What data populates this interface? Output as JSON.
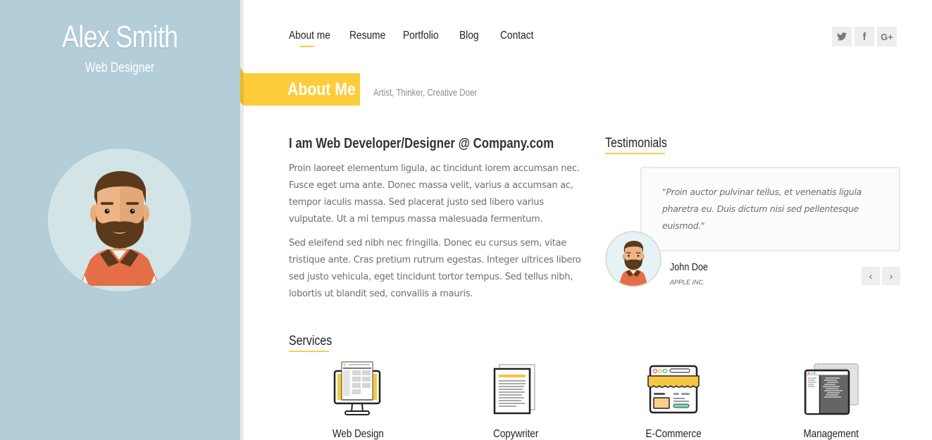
{
  "sidebar": {
    "name": "Alex Smith",
    "role": "Web Designer",
    "avatar_icon": "bearded-man-avatar-icon"
  },
  "nav": {
    "items": [
      {
        "label": "About me",
        "active": true
      },
      {
        "label": "Resume",
        "active": false
      },
      {
        "label": "Portfolio",
        "active": false
      },
      {
        "label": "Blog",
        "active": false
      },
      {
        "label": "Contact",
        "active": false
      }
    ]
  },
  "social": [
    {
      "icon": "twitter-icon",
      "glyph": "🐦"
    },
    {
      "icon": "facebook-icon",
      "glyph": "f"
    },
    {
      "icon": "google-plus-icon",
      "glyph": "G+"
    }
  ],
  "section": {
    "title": "About Me",
    "subtitle": "Artist, Thinker, Creative Doer"
  },
  "about": {
    "heading": "I am Web Developer/Designer @ Company.com",
    "paragraphs": [
      "Proin laoreet elementum ligula, ac tincidunt lorem accumsan nec. Fusce eget urna ante. Donec massa velit, varius a accumsan ac, tempor iaculis massa. Sed placerat justo sed libero varius vulputate. Ut a mi tempus massa malesuada fermentum.",
      "Sed eleifend sed nibh nec fringilla. Donec eu cursus sem, vitae tristique ante. Cras pretium rutrum egestas. Integer ultrices libero sed justo vehicula, eget tincidunt tortor tempus. Sed tellus nibh, lobortis ut blandit sed, convallis a mauris."
    ]
  },
  "testimonials": {
    "title": "Testimonials",
    "quote": "\"Proin auctor pulvinar tellus, et venenatis ligula pharetra eu. Duis dictum nisi sed pellentesque euismod.\"",
    "author": "John Doe",
    "company": "APPLE INC.",
    "prev_glyph": "‹",
    "next_glyph": "›"
  },
  "services": {
    "title": "Services",
    "items": [
      {
        "label": "Web Design",
        "icon": "monitor-webpage-icon"
      },
      {
        "label": "Copywriter",
        "icon": "document-pages-icon"
      },
      {
        "label": "E-Commerce",
        "icon": "storefront-browser-icon"
      },
      {
        "label": "Management",
        "icon": "code-windows-icon"
      }
    ]
  },
  "colors": {
    "sidebar": "#b3cdd9",
    "accent": "#fdcc39",
    "shirt": "#e46f46",
    "beard": "#5b3a1c"
  }
}
